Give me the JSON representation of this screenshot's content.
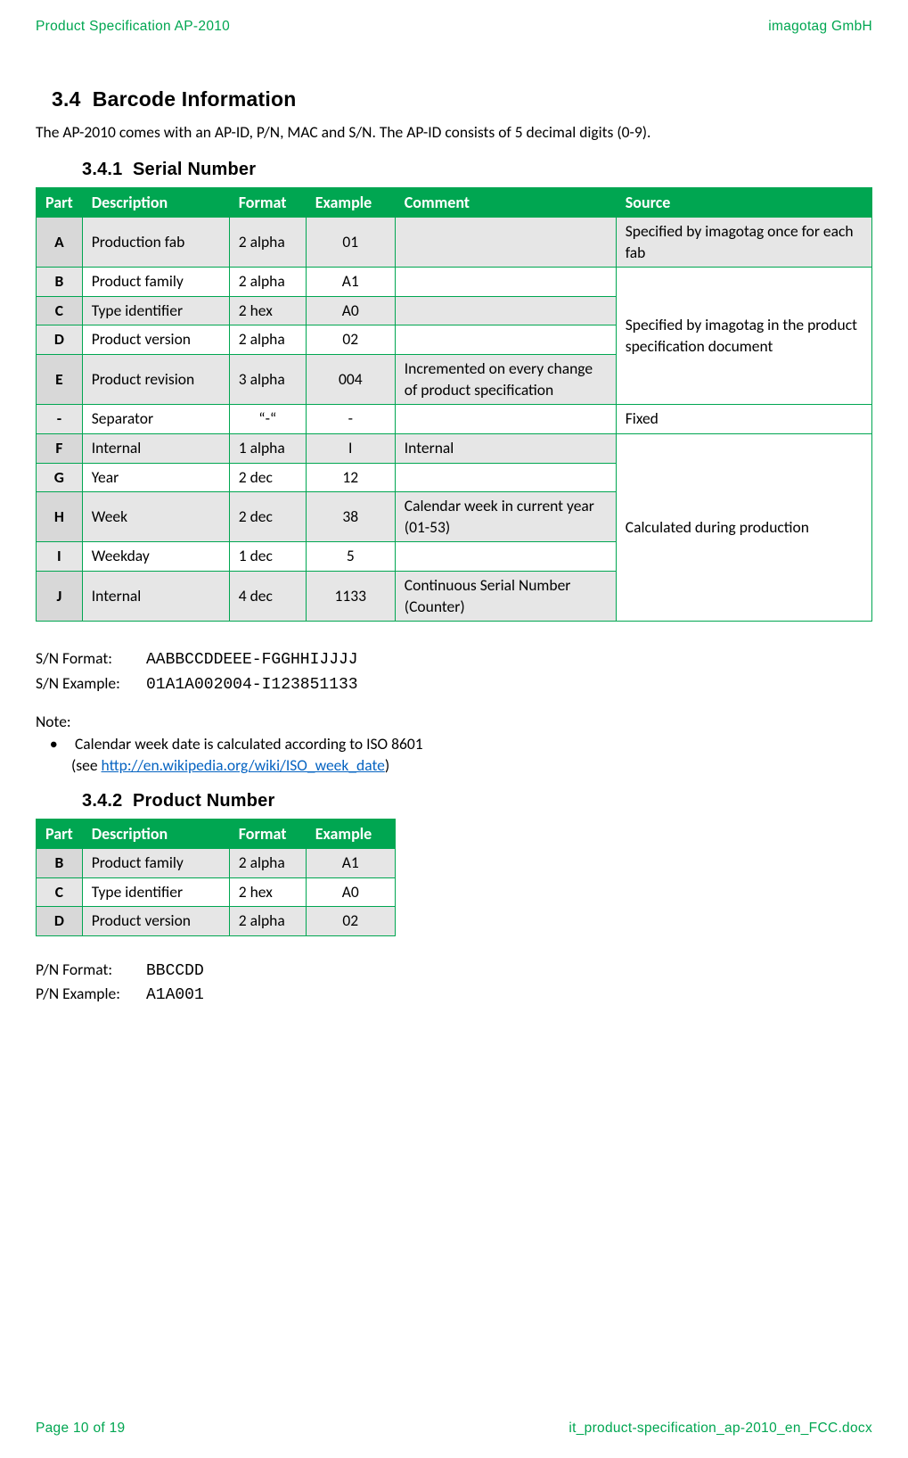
{
  "header": {
    "left": "Product Specification AP-2010",
    "right": "imagotag GmbH"
  },
  "footer": {
    "left": "Page 10 of 19",
    "right": "it_product-specification_ap-2010_en_FCC.docx"
  },
  "section_34": {
    "number": "3.4",
    "title": "Barcode Information",
    "intro": "The AP-2010 comes with an AP-ID, P/N, MAC and S/N. The AP-ID consists of 5 decimal digits (0-9)."
  },
  "section_341": {
    "number": "3.4.1",
    "title": "Serial Number",
    "headers": [
      "Part",
      "Description",
      "Format",
      "Example",
      "Comment",
      "Source"
    ],
    "rows": {
      "A": {
        "part": "A",
        "desc": "Production fab",
        "format": "2 alpha",
        "example": "01",
        "comment": "",
        "source": "Specified by imagotag once for each fab"
      },
      "B": {
        "part": "B",
        "desc": "Product family",
        "format": "2 alpha",
        "example": "A1",
        "comment": ""
      },
      "C": {
        "part": "C",
        "desc": "Type identifier",
        "format": "2 hex",
        "example": "A0",
        "comment": ""
      },
      "D": {
        "part": "D",
        "desc": "Product version",
        "format": "2 alpha",
        "example": "02",
        "comment": ""
      },
      "E": {
        "part": "E",
        "desc": "Product revision",
        "format": "3 alpha",
        "example": "004",
        "comment": "Incremented on every change of product specification"
      },
      "source_bcde": "Specified by imagotag in the product specification document",
      "sep": {
        "part": "-",
        "desc": "Separator",
        "format": "“-“",
        "example": "-",
        "comment": "",
        "source": "Fixed"
      },
      "F": {
        "part": "F",
        "desc": "Internal",
        "format": "1 alpha",
        "example": "I",
        "comment": "Internal"
      },
      "G": {
        "part": "G",
        "desc": "Year",
        "format": "2 dec",
        "example": "12",
        "comment": ""
      },
      "H": {
        "part": "H",
        "desc": "Week",
        "format": "2 dec",
        "example": "38",
        "comment": "Calendar week in current year (01-53)"
      },
      "I": {
        "part": "I",
        "desc": "Weekday",
        "format": "1 dec",
        "example": "5",
        "comment": ""
      },
      "J": {
        "part": "J",
        "desc": "Internal",
        "format": "4 dec",
        "example": "1133",
        "comment": "Continuous Serial Number (Counter)"
      },
      "source_fghij": "Calculated during production"
    },
    "sn_format_label": "S/N Format:",
    "sn_format_value": "AABBCCDDEEE-FGGHHIJJJJ",
    "sn_example_label": "S/N Example:",
    "sn_example_value": "01A1A002004-I123851133",
    "note_label": "Note:",
    "note_text_pre": "Calendar week date is calculated according to ISO 8601",
    "note_text_see": "(see ",
    "note_link_text": "http://en.wikipedia.org/wiki/ISO_week_date",
    "note_text_close": ")"
  },
  "section_342": {
    "number": "3.4.2",
    "title": "Product Number",
    "headers": [
      "Part",
      "Description",
      "Format",
      "Example"
    ],
    "rows": {
      "B": {
        "part": "B",
        "desc": "Product family",
        "format": "2 alpha",
        "example": "A1"
      },
      "C": {
        "part": "C",
        "desc": "Type identifier",
        "format": "2 hex",
        "example": "A0"
      },
      "D": {
        "part": "D",
        "desc": "Product version",
        "format": "2 alpha",
        "example": "02"
      }
    },
    "pn_format_label": "P/N Format:",
    "pn_format_value": "BBCCDD",
    "pn_example_label": "P/N Example:",
    "pn_example_value": "A1A001"
  }
}
